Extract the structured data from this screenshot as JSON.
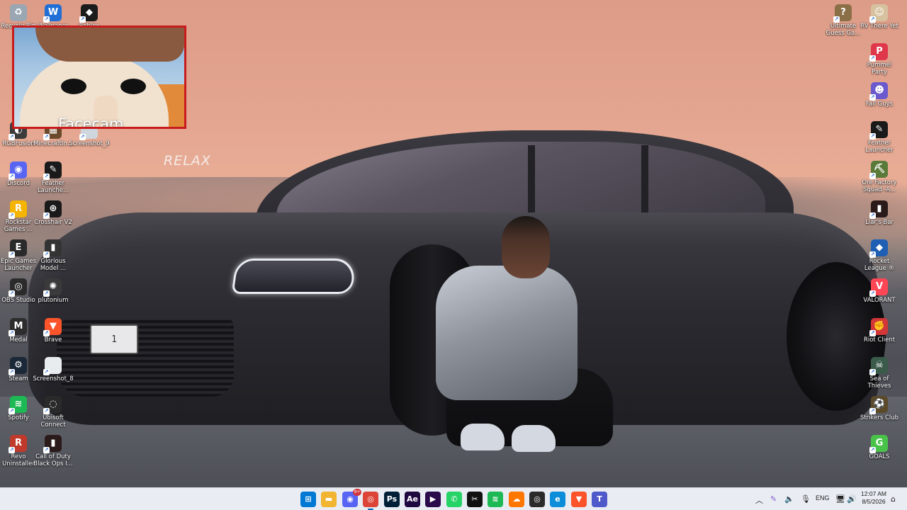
{
  "wallpaper": {
    "overlay_text": "RELAX",
    "plate_text": "1"
  },
  "facecam": {
    "label": "Facecam"
  },
  "desktop_left": [
    {
      "label": "Recycle Bin",
      "icon": "recycle-bin-icon",
      "color": "#9aa6b2",
      "glyph": "♻"
    },
    {
      "label": "Wallpaper",
      "icon": "wallpaper-engine-icon",
      "color": "#1f6fd6",
      "glyph": "W"
    },
    {
      "label": "Roblox",
      "icon": "roblox-icon",
      "color": "#1b1b1b",
      "glyph": "◆"
    },
    {
      "label": "RGBFusion",
      "icon": "rgbfusion-icon",
      "color": "#3b3b3b",
      "glyph": "◐"
    },
    {
      "label": "MinecraftIn...",
      "icon": "minecraft-icon",
      "color": "#6b4a2b",
      "glyph": "▦"
    },
    {
      "label": "Screenshot_9",
      "icon": "image-file-icon",
      "color": "#cfd6dd",
      "glyph": ""
    },
    {
      "label": "Discord",
      "icon": "discord-icon",
      "color": "#5865f2",
      "glyph": "◉"
    },
    {
      "label": "Feather Launche...",
      "icon": "feather-launcher-icon",
      "color": "#1a1a1a",
      "glyph": "✎"
    },
    {
      "label": "Rockstar Games ...",
      "icon": "rockstar-icon",
      "color": "#f4b400",
      "glyph": "R"
    },
    {
      "label": "Crosshair V2",
      "icon": "crosshair-icon",
      "color": "#1a1a1a",
      "glyph": "⊕"
    },
    {
      "label": "Epic Games Launcher",
      "icon": "epic-games-icon",
      "color": "#2a2a2a",
      "glyph": "E"
    },
    {
      "label": "Glorious Model ...",
      "icon": "glorious-icon",
      "color": "#333",
      "glyph": "▮"
    },
    {
      "label": "OBS Studio",
      "icon": "obs-icon",
      "color": "#2b2b2b",
      "glyph": "◎"
    },
    {
      "label": "plutonium",
      "icon": "plutonium-icon",
      "color": "#3a3a3a",
      "glyph": "✺"
    },
    {
      "label": "Medal",
      "icon": "medal-icon",
      "color": "#2d2d2d",
      "glyph": "M"
    },
    {
      "label": "Brave",
      "icon": "brave-icon",
      "color": "#fb542b",
      "glyph": "▼"
    },
    {
      "label": "Steam",
      "icon": "steam-icon",
      "color": "#1b2838",
      "glyph": "⚙"
    },
    {
      "label": "Screenshot_8",
      "icon": "image-file-icon",
      "color": "#e8ecef",
      "glyph": ""
    },
    {
      "label": "Spotify",
      "icon": "spotify-icon",
      "color": "#1db954",
      "glyph": "≋"
    },
    {
      "label": "Ubisoft Connect",
      "icon": "ubisoft-icon",
      "color": "#2a2a2a",
      "glyph": "◌"
    },
    {
      "label": "Revo Uninstaller",
      "icon": "revo-uninstaller-icon",
      "color": "#c0392b",
      "glyph": "R"
    },
    {
      "label": "Call of Duty Black Ops I...",
      "icon": "cod-icon",
      "color": "#2b1a1a",
      "glyph": "▮"
    }
  ],
  "desktop_right": [
    {
      "label": "Ultimate Guess Ga...",
      "icon": "guess-game-icon",
      "color": "#8b6f47",
      "glyph": "?"
    },
    {
      "label": "RV There Yet",
      "icon": "rv-there-yet-icon",
      "color": "#d7c2a0",
      "glyph": "☺"
    },
    {
      "label": "Pummel Party",
      "icon": "pummel-party-icon",
      "color": "#e0384b",
      "glyph": "P"
    },
    {
      "label": "Fall Guys",
      "icon": "fall-guys-icon",
      "color": "#6a5acd",
      "glyph": "☻"
    },
    {
      "label": "Feather Launcher",
      "icon": "feather-launcher-icon",
      "color": "#1a1a1a",
      "glyph": "✎"
    },
    {
      "label": "Ore Factory Squad -A...",
      "icon": "ore-factory-icon",
      "color": "#5a7a3a",
      "glyph": "⛏"
    },
    {
      "label": "Liar's Bar",
      "icon": "liars-bar-icon",
      "color": "#2a1a1a",
      "glyph": "▮"
    },
    {
      "label": "Rocket League ®",
      "icon": "rocket-league-icon",
      "color": "#1e5fb4",
      "glyph": "◆"
    },
    {
      "label": "VALORANT",
      "icon": "valorant-icon",
      "color": "#ff4655",
      "glyph": "V"
    },
    {
      "label": "Riot Client",
      "icon": "riot-client-icon",
      "color": "#d13639",
      "glyph": "✊"
    },
    {
      "label": "Sea of Thieves",
      "icon": "sea-of-thieves-icon",
      "color": "#3a5a4a",
      "glyph": "☠"
    },
    {
      "label": "Strikers Club",
      "icon": "strikers-club-icon",
      "color": "#5a4a2a",
      "glyph": "⚽"
    },
    {
      "label": "GOALS",
      "icon": "goals-icon",
      "color": "#49c24a",
      "glyph": "G"
    }
  ],
  "taskbar": {
    "apps": [
      {
        "icon": "windows-start-icon",
        "color": "#0078d4",
        "glyph": "⊞"
      },
      {
        "icon": "file-explorer-icon",
        "color": "#f2b531",
        "glyph": "▬"
      },
      {
        "icon": "discord-icon",
        "color": "#5865f2",
        "glyph": "◉",
        "badge": "9+"
      },
      {
        "icon": "chrome-icon",
        "color": "#db4437",
        "glyph": "◎",
        "active": true
      },
      {
        "icon": "photoshop-icon",
        "color": "#001e36",
        "glyph": "Ps"
      },
      {
        "icon": "after-effects-icon",
        "color": "#1f0740",
        "glyph": "Ae"
      },
      {
        "icon": "premiere-icon",
        "color": "#2a0a4a",
        "glyph": "▶"
      },
      {
        "icon": "whatsapp-icon",
        "color": "#25d366",
        "glyph": "✆"
      },
      {
        "icon": "capcut-icon",
        "color": "#111",
        "glyph": "✂"
      },
      {
        "icon": "spotify-icon",
        "color": "#1db954",
        "glyph": "≋"
      },
      {
        "icon": "soundcloud-icon",
        "color": "#ff7700",
        "glyph": "☁"
      },
      {
        "icon": "obs-icon",
        "color": "#2b2b2b",
        "glyph": "◎"
      },
      {
        "icon": "edge-icon",
        "color": "#0c8dd9",
        "glyph": "e"
      },
      {
        "icon": "brave-icon",
        "color": "#fb542b",
        "glyph": "▼"
      },
      {
        "icon": "teams-icon",
        "color": "#5059c9",
        "glyph": "T"
      }
    ],
    "tray": {
      "language": "ENG",
      "time": "12:07 AM",
      "date": "8/5/2026"
    }
  }
}
